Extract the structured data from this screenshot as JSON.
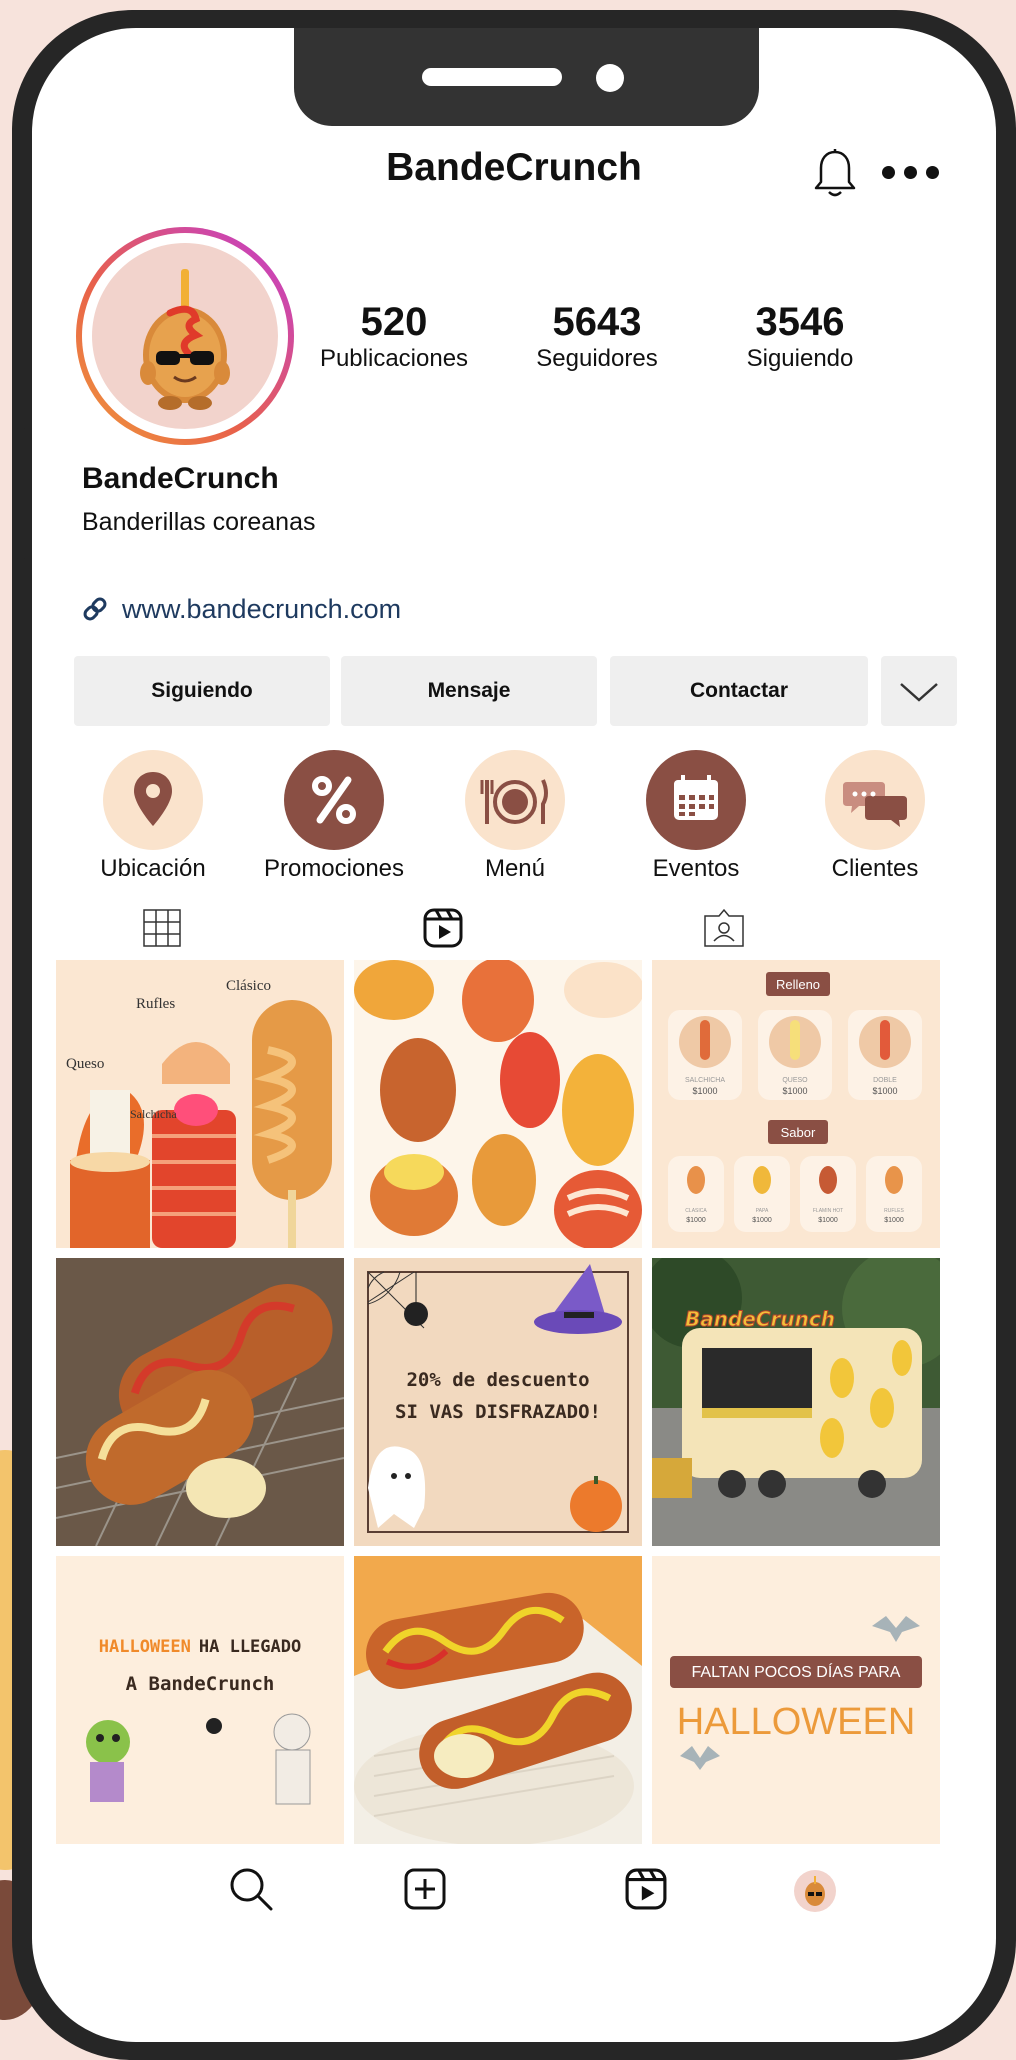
{
  "header": {
    "title": "BandeCrunch"
  },
  "stats": [
    {
      "value": "520",
      "label": "Publicaciones"
    },
    {
      "value": "5643",
      "label": "Seguidores"
    },
    {
      "value": "3546",
      "label": "Siguiendo"
    }
  ],
  "profile": {
    "name": "BandeCrunch",
    "bio": "Banderillas coreanas",
    "link": "www.bandecrunch.com"
  },
  "actions": {
    "following": "Siguiendo",
    "message": "Mensaje",
    "contact": "Contactar"
  },
  "highlights": [
    {
      "label": "Ubicación",
      "icon": "location-pin-icon"
    },
    {
      "label": "Promociones",
      "icon": "percent-icon"
    },
    {
      "label": "Menú",
      "icon": "fork-plate-knife-icon"
    },
    {
      "label": "Eventos",
      "icon": "calendar-icon"
    },
    {
      "label": "Clientes",
      "icon": "chat-bubbles-icon"
    }
  ],
  "tabs": [
    "grid-icon",
    "reels-icon",
    "tagged-icon"
  ],
  "posts": {
    "p1": {
      "labels": [
        "Rufles",
        "Clásico",
        "Queso",
        "Salchicha"
      ]
    },
    "p3": {
      "heading1": "Relleno",
      "heading2": "Sabor",
      "row1": [
        {
          "name": "SALCHICHA",
          "price": "$1000"
        },
        {
          "name": "QUESO",
          "price": "$1000"
        },
        {
          "name": "DOBLE",
          "price": "$1000"
        }
      ],
      "row2": [
        {
          "name": "CLASICA",
          "price": "$1000"
        },
        {
          "name": "PAPA",
          "price": "$1000"
        },
        {
          "name": "FLAMIN HOT",
          "price": "$1000"
        },
        {
          "name": "RUFLES",
          "price": "$1000"
        }
      ]
    },
    "p5": {
      "line1": "20% de descuento",
      "line2": "SI VAS DISFRAZADO!"
    },
    "p6": {
      "sign": "BandeCrunch"
    },
    "p7": {
      "word1": "HALLOWEEN",
      "word2": "HA LLEGADO",
      "line2": "A BandeCrunch"
    },
    "p9": {
      "banner": "FALTAN POCOS DÍAS PARA",
      "word": "HALLOWEEN"
    }
  },
  "bottom_nav": [
    "search-icon",
    "add-post-icon",
    "reels-icon",
    "profile-avatar-icon"
  ],
  "colors": {
    "accent_brown": "#8a4f44",
    "accent_cream": "#fae3cc",
    "link": "#1e3a5f",
    "frame": "#262626"
  }
}
